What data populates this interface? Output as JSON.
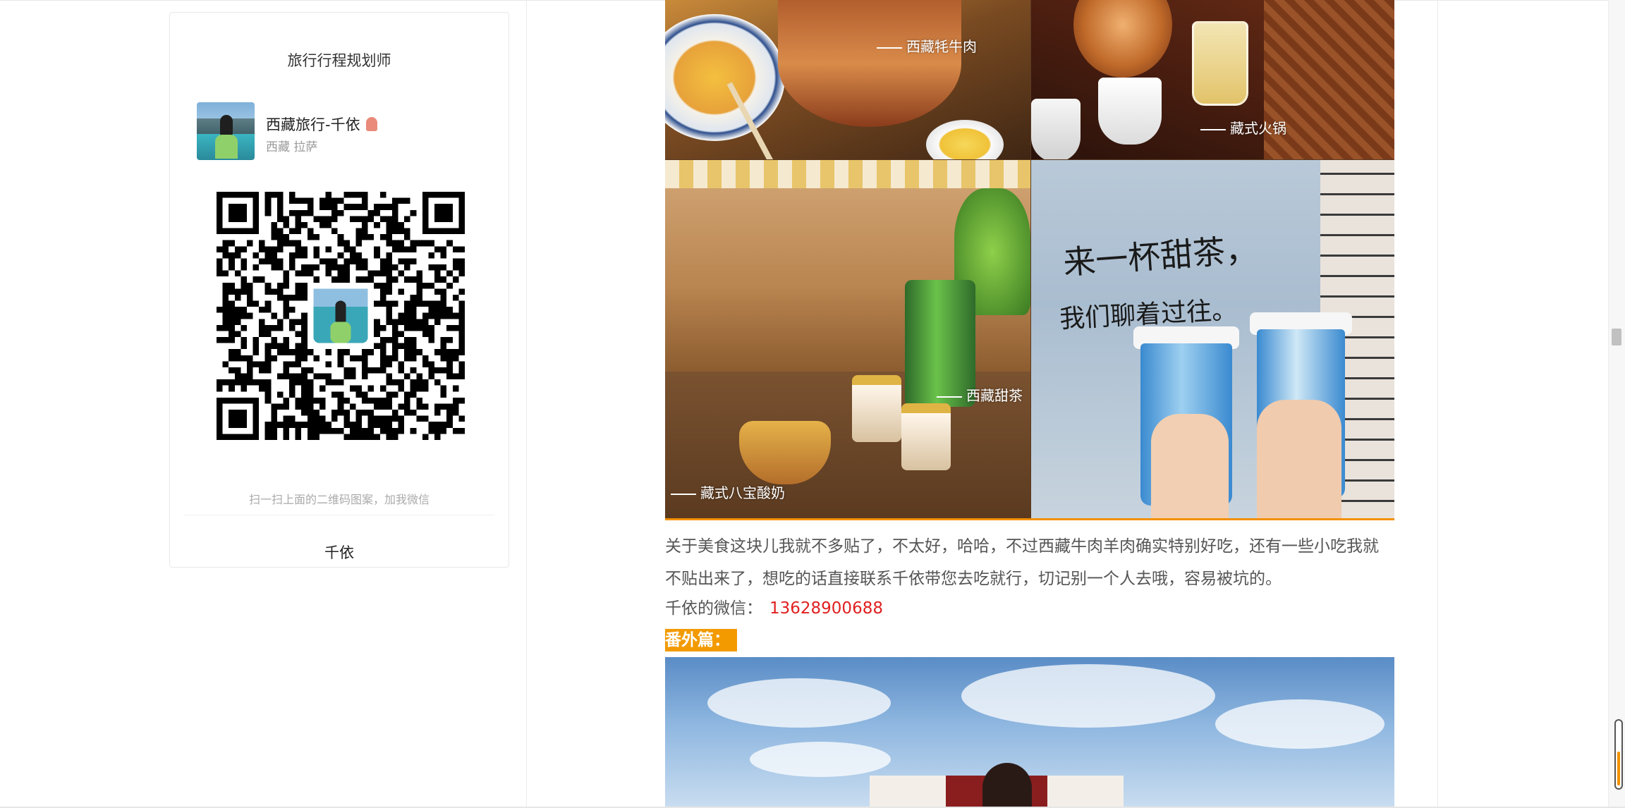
{
  "card": {
    "title": "旅行行程规划师",
    "profile_name": "西藏旅行-千依",
    "profile_location": "西藏 拉萨",
    "qr_hint": "扫一扫上面的二维码图案，加我微信",
    "name": "千依"
  },
  "article": {
    "collage_labels": {
      "yak_meat": "西藏牦牛肉",
      "hotpot": "藏式火锅",
      "sweet_tea": "西藏甜茶",
      "yogurt": "藏式八宝酸奶"
    },
    "poster_line1": "来一杯甜茶，",
    "poster_line2": "我们聊着过往。",
    "paragraph": "关于美食这块儿我就不多贴了，不太好，哈哈，不过西藏牛肉羊肉确实特别好吃，还有一些小吃我就不贴出来了，想吃的话直接联系千依带您去吃就行，切记别一个人去哦，容易被坑的。",
    "wechat_label": "千依的微信：",
    "wechat_number": "13628900688",
    "extra_heading": "番外篇："
  },
  "colors": {
    "accent_orange": "#f29a00",
    "phone_red": "#e02020"
  }
}
